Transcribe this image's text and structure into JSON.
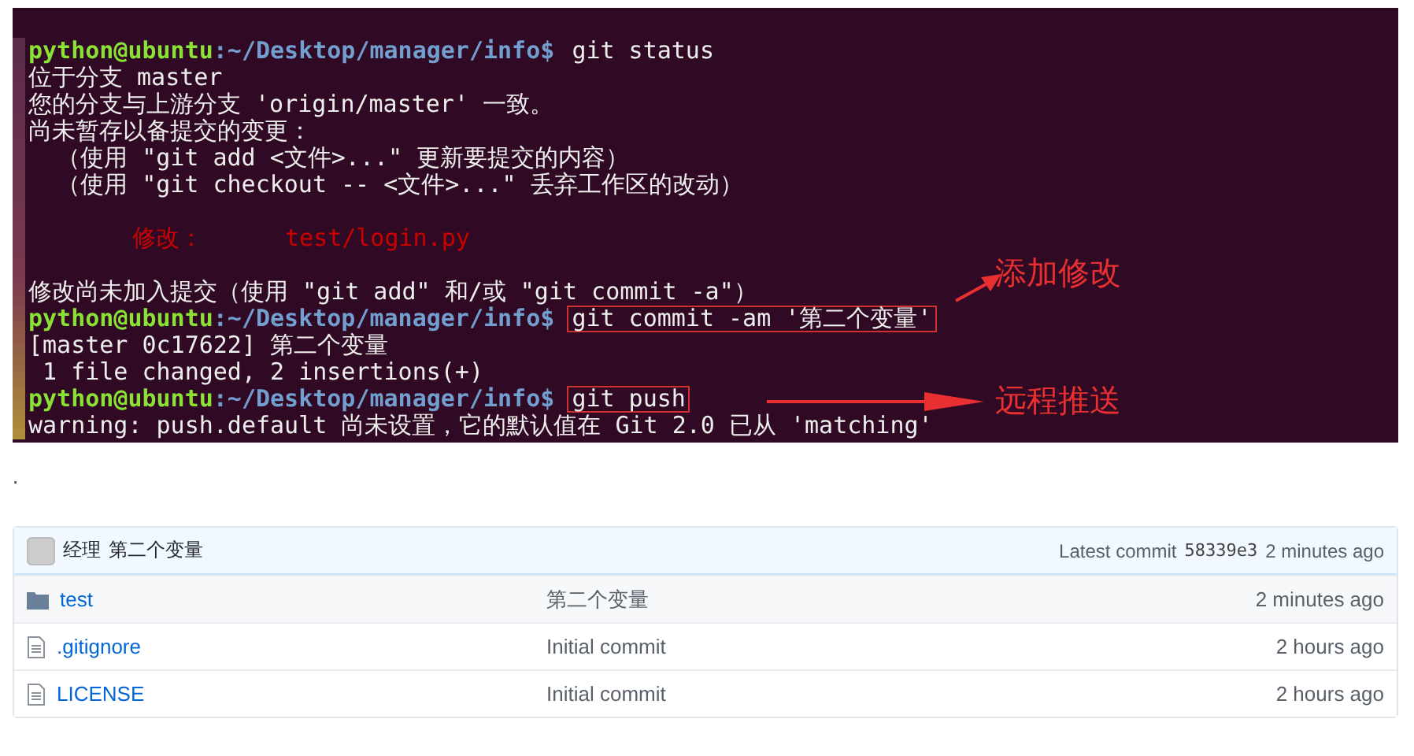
{
  "terminal": {
    "lines": [
      {
        "kind": "prompt",
        "user": "python@ubuntu",
        "path": ":~/Desktop/manager/info$",
        "command": "git status",
        "highlighted": false
      },
      {
        "kind": "output",
        "text": "位于分支 master"
      },
      {
        "kind": "output",
        "text": "您的分支与上游分支 'origin/master' 一致。"
      },
      {
        "kind": "output",
        "text": "尚未暂存以备提交的变更："
      },
      {
        "kind": "output",
        "text": "  （使用 \"git add <文件>...\" 更新要提交的内容）"
      },
      {
        "kind": "output",
        "text": "  （使用 \"git checkout -- <文件>...\" 丢弃工作区的改动）"
      },
      {
        "kind": "blank"
      },
      {
        "kind": "modified",
        "label": "修改：",
        "file": "test/login.py"
      },
      {
        "kind": "blank"
      },
      {
        "kind": "output",
        "text": "修改尚未加入提交（使用 \"git add\" 和/或 \"git commit -a\"）"
      },
      {
        "kind": "prompt",
        "user": "python@ubuntu",
        "path": ":~/Desktop/manager/info$",
        "command": "git commit -am '第二个变量'",
        "highlighted": true
      },
      {
        "kind": "output",
        "text": "[master 0c17622] 第二个变量"
      },
      {
        "kind": "output",
        "text": " 1 file changed, 2 insertions(+)"
      },
      {
        "kind": "prompt",
        "user": "python@ubuntu",
        "path": ":~/Desktop/manager/info$",
        "command": "git push",
        "highlighted": true
      },
      {
        "kind": "output",
        "text": "warning: push.default 尚未设置，它的默认值在 Git 2.0 已从 'matching'"
      }
    ],
    "annotations": [
      {
        "text": "添加修改",
        "kind": "diagonal"
      },
      {
        "text": "远程推送",
        "kind": "horizontal"
      }
    ]
  },
  "separator": ".",
  "repo": {
    "commit_bar": {
      "author": "经理",
      "message": "第二个变量",
      "latest_label": "Latest commit",
      "sha": "58339e3",
      "age": "2 minutes ago"
    },
    "rows": [
      {
        "kind": "folder",
        "name": "test",
        "message": "第二个变量",
        "age": "2 minutes ago"
      },
      {
        "kind": "file",
        "name": ".gitignore",
        "message": "Initial commit",
        "age": "2 hours ago"
      },
      {
        "kind": "file",
        "name": "LICENSE",
        "message": "Initial commit",
        "age": "2 hours ago"
      }
    ]
  }
}
